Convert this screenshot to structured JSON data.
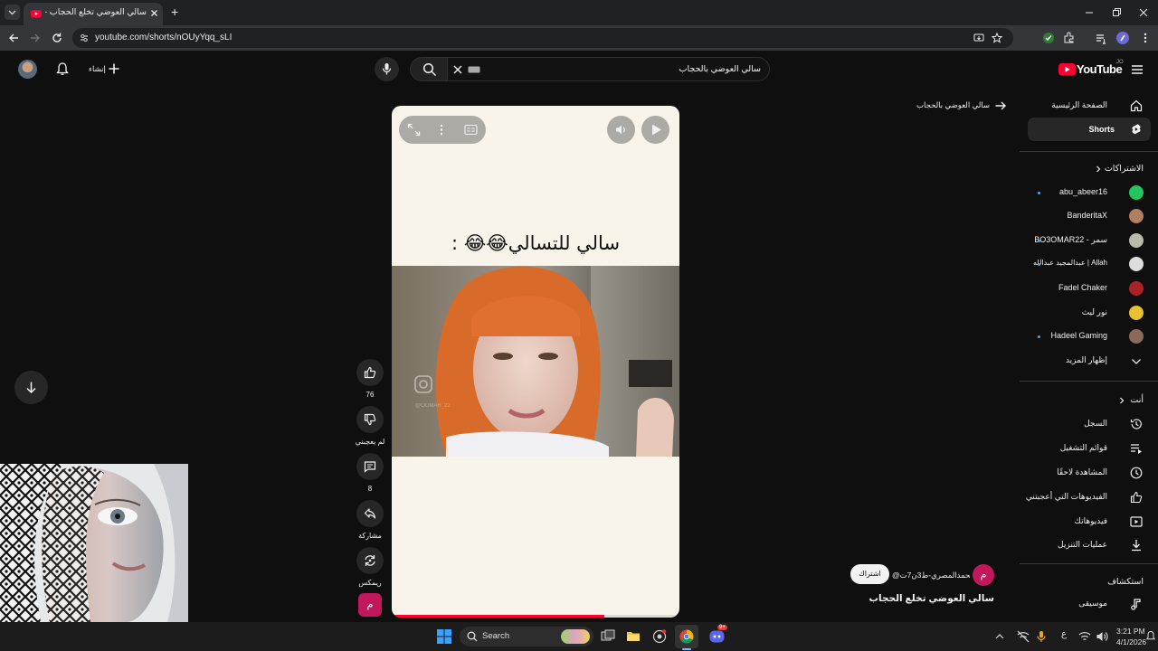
{
  "browser": {
    "tab_title": "سالي العوضي تخلع الحجاب - ube",
    "url": "youtube.com/shorts/nOUyYqq_sLI",
    "new_tab": "+"
  },
  "youtube": {
    "logo_text": "YouTube",
    "logo_country": "JO",
    "search_value": "سالي العوضي بالحجاب",
    "create_label": "إنشاء",
    "back_link": "سالي العوضي بالحجاب"
  },
  "sidebar": {
    "main": [
      {
        "label": "الصفحة الرئيسية",
        "icon": "home-icon"
      },
      {
        "label": "Shorts",
        "icon": "shorts-icon",
        "active": true
      }
    ],
    "subs_title": "الاشتراكات",
    "subs": [
      {
        "label": "abu_abeer16",
        "dot": true,
        "color": "#22c55e"
      },
      {
        "label": "BanderitaX",
        "dot": false,
        "color": "#b08060"
      },
      {
        "label": "BO3OMAR22 - سمر",
        "dot": true,
        "color": "#bbbbaa"
      },
      {
        "label": "عبدالمجيد عبدالله | Allah",
        "dot": true,
        "color": "#dddddd"
      },
      {
        "label": "Fadel Chaker",
        "dot": false,
        "color": "#aa2222"
      },
      {
        "label": "نور ليث",
        "dot": false,
        "color": "#e8c030"
      },
      {
        "label": "Hadeel Gaming",
        "dot": true,
        "color": "#8a6a5a"
      }
    ],
    "show_more": "إظهار المزيد",
    "you_title": "أنت",
    "you": [
      {
        "label": "السجل",
        "icon": "history-icon"
      },
      {
        "label": "قوائم التشغيل",
        "icon": "playlists-icon"
      },
      {
        "label": "المشاهدة لاحقًا",
        "icon": "watch-later-icon"
      },
      {
        "label": "الفيديوهات التي أعجبتني",
        "icon": "liked-icon"
      },
      {
        "label": "فيديوهاتك",
        "icon": "your-videos-icon"
      },
      {
        "label": "عمليات التنزيل",
        "icon": "downloads-icon"
      }
    ],
    "explore_title": "استكشاف",
    "explore": [
      {
        "label": "موسيقى",
        "icon": "music-icon"
      }
    ]
  },
  "short": {
    "caption": "سالي للتسالي😂😂 :",
    "watermark": "@OOMAR_22",
    "progress_fraction": 0.74,
    "channel": "@محمدالمصري-ط3ن7ت",
    "channel_initial": "م",
    "subscribe": "اشتراك",
    "title": "سالي العوضي تخلع الحجاب"
  },
  "actions": {
    "likes": "76",
    "dislike": "لم يعجبني",
    "comments": "8",
    "share": "مشاركة",
    "remix": "ريمكس",
    "channel_initial": "م"
  },
  "taskbar": {
    "search": "Search",
    "lang": "ع",
    "time": "3:21 PM",
    "date": "4/1/2026",
    "badge": "9+"
  },
  "colors": {
    "accent_red": "#ff0033",
    "channel_avatar": "#c2185b"
  }
}
